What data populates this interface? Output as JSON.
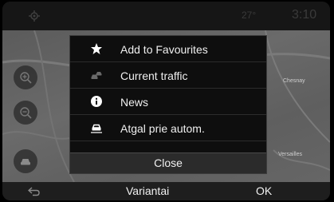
{
  "status_bar": {
    "temperature": "27°",
    "clock": "3:10",
    "gps_icon": "gps-locate-icon"
  },
  "map": {
    "place_labels": [
      "Chesnay",
      "Versailles"
    ],
    "buttons": [
      "zoom-in-icon",
      "zoom-out-icon",
      "car-icon"
    ]
  },
  "dialog": {
    "items": [
      {
        "label": "Add to Favourites",
        "icon": "star-icon"
      },
      {
        "label": "Current traffic",
        "icon": "traffic-icon"
      },
      {
        "label": "News",
        "icon": "info-icon"
      },
      {
        "label": "Atgal prie autom.",
        "icon": "car-icon"
      }
    ],
    "close_label": "Close"
  },
  "bottom_bar": {
    "back_icon": "back-arrow-icon",
    "options_label": "Variantai",
    "ok_label": "OK"
  },
  "colors": {
    "dialog_background": "#0e0e0e",
    "close_button": "#2b2b2b",
    "map": "#5f5f5f",
    "text": "#f0f0f0"
  }
}
